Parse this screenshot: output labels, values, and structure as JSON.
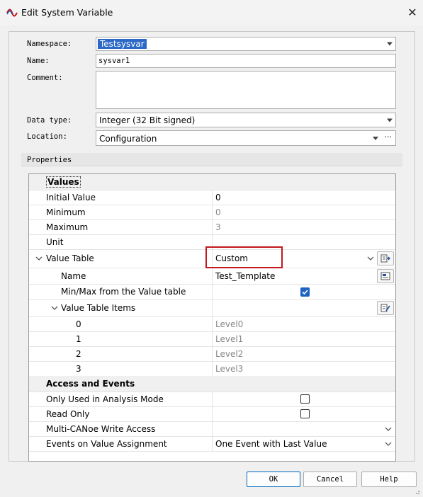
{
  "window": {
    "title": "Edit System Variable",
    "close_glyph": "✕"
  },
  "form": {
    "namespace": {
      "label": "Namespace:",
      "value": "Testsysvar"
    },
    "name": {
      "label": "Name:",
      "value": "sysvar1"
    },
    "comment": {
      "label": "Comment:",
      "value": ""
    },
    "data_type": {
      "label": "Data type:",
      "value": "Integer (32 Bit signed)"
    },
    "location": {
      "label": "Location:",
      "value": "Configuration",
      "more": "···"
    }
  },
  "properties": {
    "label": "Properties",
    "values_section": "Values",
    "rows": {
      "initial_value": {
        "name": "Initial Value",
        "value": "0"
      },
      "minimum": {
        "name": "Minimum",
        "value": "0"
      },
      "maximum": {
        "name": "Maximum",
        "value": "3"
      },
      "unit": {
        "name": "Unit",
        "value": ""
      },
      "value_table": {
        "name": "Value Table",
        "value": "Custom"
      },
      "vt_name": {
        "name": "Name",
        "value": "Test_Template"
      },
      "vt_minmax": {
        "name": "Min/Max from the Value table",
        "checked": true
      },
      "vt_items": {
        "name": "Value Table Items"
      },
      "items": [
        {
          "key": "0",
          "value": "Level0"
        },
        {
          "key": "1",
          "value": "Level1"
        },
        {
          "key": "2",
          "value": "Level2"
        },
        {
          "key": "3",
          "value": "Level3"
        }
      ]
    },
    "access_section": "Access and Events",
    "access_rows": {
      "analysis_mode": {
        "name": "Only Used in Analysis Mode",
        "checked": false
      },
      "read_only": {
        "name": "Read Only",
        "checked": false
      },
      "multi_canoe": {
        "name": "Multi-CANoe Write Access",
        "value": ""
      },
      "events": {
        "name": "Events on Value Assignment",
        "value": "One Event with Last Value"
      }
    }
  },
  "buttons": {
    "ok": "OK",
    "cancel": "Cancel",
    "help": "Help"
  },
  "colors": {
    "selection": "#2b68c8",
    "highlight_box": "#c0181c",
    "checkbox_on": "#1e63c4"
  }
}
